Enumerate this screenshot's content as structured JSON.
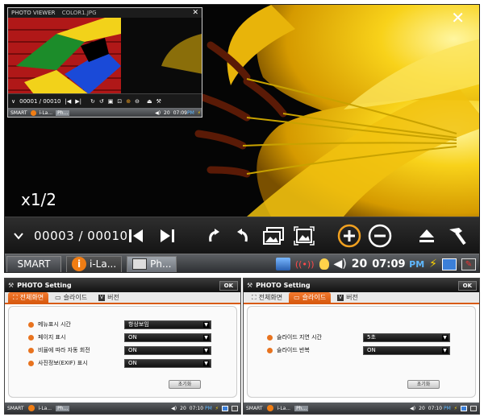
{
  "viewer": {
    "zoom": "x1/2",
    "counter": "00003 / 00010"
  },
  "taskbar": {
    "smart": "SMART",
    "app1": "i-La...",
    "app2": "Ph...",
    "volume": "20",
    "time": "07:09",
    "ampm": "PM"
  },
  "mini": {
    "title": "PHOTO VIEWER",
    "filename": "COLOR1.JPG",
    "counter": "00001 / 00010",
    "smart": "SMART",
    "app1": "i-La...",
    "app2": "Ph...",
    "volume": "20",
    "time": "07:09",
    "ampm": "PM"
  },
  "settings1": {
    "title": "PHOTO Setting",
    "ok": "OK",
    "tabs": [
      "전체화면",
      "슬라이드",
      "버전"
    ],
    "rows": [
      {
        "label": "메뉴표시 시간",
        "value": "항상보임"
      },
      {
        "label": "페이지 표시",
        "value": "ON"
      },
      {
        "label": "비율에 따라 자동 회전",
        "value": "ON"
      },
      {
        "label": "사진정보(EXIF) 표시",
        "value": "ON"
      }
    ],
    "reset": "초기화",
    "smart": "SMART",
    "app1": "i-La...",
    "app2": "Ph...",
    "volume": "20",
    "time": "07:10",
    "ampm": "PM"
  },
  "settings2": {
    "title": "PHOTO Setting",
    "ok": "OK",
    "tabs": [
      "전체화면",
      "슬라이드",
      "버전"
    ],
    "rows": [
      {
        "label": "슬라이드 지연 시간",
        "value": "5초"
      },
      {
        "label": "슬라이드 반복",
        "value": "ON"
      }
    ],
    "reset": "초기화",
    "smart": "SMART",
    "app1": "i-La...",
    "app2": "Ph...",
    "volume": "20",
    "time": "07:10",
    "ampm": "PM"
  },
  "colors": {
    "accent": "#d85a10",
    "ampm": "#5fb8ff",
    "bullet": "#e8731f"
  }
}
